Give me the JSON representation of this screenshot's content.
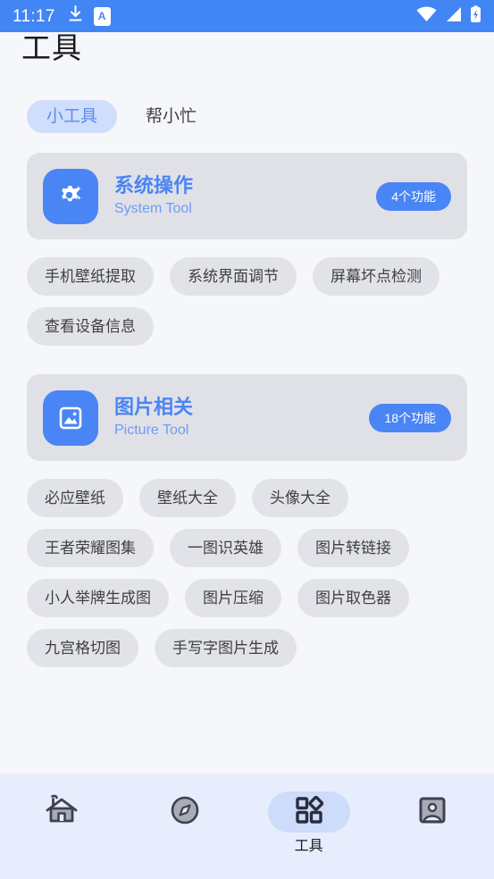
{
  "status_bar": {
    "time": "11:17",
    "download_icon": "download-icon",
    "ime_icon_label": "A",
    "wifi_icon": "wifi-icon",
    "signal_icon": "cellular-signal-icon",
    "battery_icon": "battery-charging-icon"
  },
  "header": {
    "title": "工具"
  },
  "colors": {
    "status_bar_bg": "#4285f4",
    "page_bg": "#f6f7fb",
    "accent_blue": "#4a85f5",
    "accent_blue_light": "#6f9bf7",
    "tab_active_bg": "#cfdefb",
    "tab_active_text": "#5b8def",
    "card_bg": "#e0e1e7",
    "chip_bg": "#e2e3e9",
    "chip_text": "#3f4044",
    "nav_bg": "#e8edfd",
    "nav_pill_bg": "#ccdcfa",
    "nav_icon": "#3f4052"
  },
  "tabs": [
    {
      "label": "小工具",
      "active": true
    },
    {
      "label": "帮小忙",
      "active": false
    }
  ],
  "groups": [
    {
      "title": "系统操作",
      "subtitle": "System Tool",
      "badge": "4个功能",
      "icon": "gear-sparkle-icon",
      "items": [
        "手机壁纸提取",
        "系统界面调节",
        "屏幕坏点检测",
        "查看设备信息"
      ]
    },
    {
      "title": "图片相关",
      "subtitle": "Picture Tool",
      "badge": "18个功能",
      "icon": "picture-icon",
      "items": [
        "必应壁纸",
        "壁纸大全",
        "头像大全",
        "王者荣耀图集",
        "一图识英雄",
        "图片转链接",
        "小人举牌生成图",
        "图片压缩",
        "图片取色器",
        "九宫格切图",
        "手写字图片生成"
      ]
    }
  ],
  "bottom_nav": [
    {
      "label": "",
      "icon": "home-icon",
      "active": false
    },
    {
      "label": "",
      "icon": "compass-icon",
      "active": false
    },
    {
      "label": "工具",
      "icon": "tools-grid-icon",
      "active": true
    },
    {
      "label": "",
      "icon": "profile-icon",
      "active": false
    }
  ]
}
